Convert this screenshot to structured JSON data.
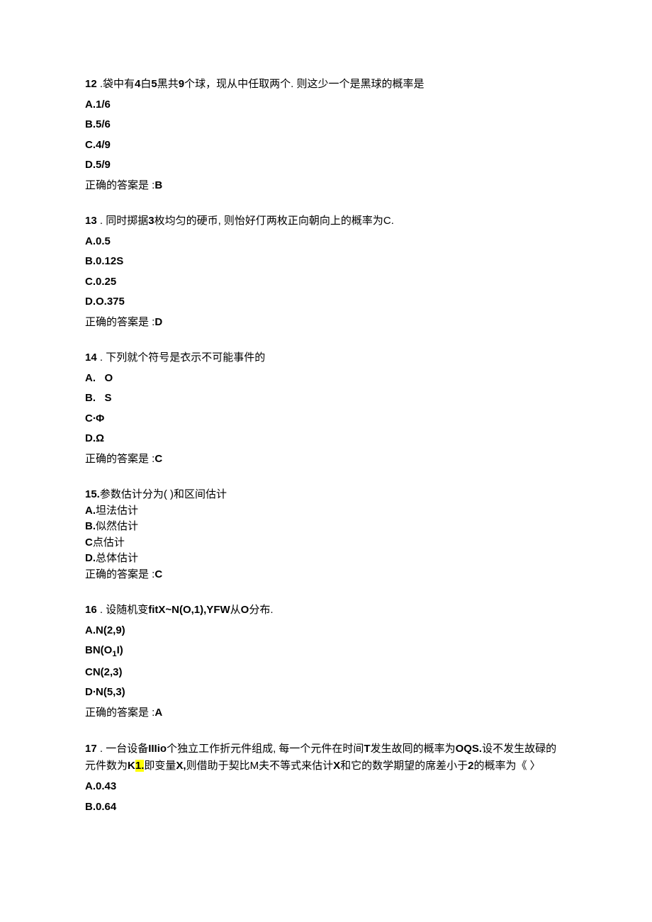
{
  "questions": [
    {
      "num": "12",
      "sep": " .",
      "text": "袋中有",
      "bold1": "4",
      "text2": "白",
      "bold2": "5",
      "text3": "黑共",
      "bold3": "9",
      "text4": "个球，现从中任取两个. 则这少一个是黑球的概率是",
      "options": [
        {
          "label": "A.1/6",
          "bold": true
        },
        {
          "label": "B.5/6",
          "bold": true
        },
        {
          "label": "C.4/9",
          "bold": true
        },
        {
          "label": "D.5/9",
          "bold": true
        }
      ],
      "answer_prefix": "正确的答案是 :",
      "answer": "B"
    },
    {
      "num": "13",
      "sep": " . ",
      "text": "同时掷据",
      "bold1": "3",
      "text2": "枚均匀的硬币, 则怡好仃两枚正向朝向上的概率为C.",
      "options": [
        {
          "label": "A.0.5",
          "bold": true
        },
        {
          "label": "B.0.12S",
          "bold": true
        },
        {
          "label": "C.0.25",
          "bold": true
        },
        {
          "label": "D.O.375",
          "bold": true
        }
      ],
      "answer_prefix": "正确的答案是 :",
      "answer": "D"
    },
    {
      "num": "14",
      "sep": " . ",
      "text": "下列就个符号是衣示不可能事件的",
      "options": [
        {
          "label_a": "A.",
          "label_b": "O",
          "bold": true,
          "spaced": true
        },
        {
          "label_a": "B.",
          "label_b": "S",
          "bold": true,
          "spaced": true
        },
        {
          "label": "C∙Φ",
          "bold": true
        },
        {
          "label": "D.Ω",
          "bold": true
        }
      ],
      "answer_prefix": "正确的答案是 :",
      "answer": "C"
    },
    {
      "num": "15.",
      "text": "参数估计分为(            )和区间估计",
      "options": [
        {
          "label_a": "A.",
          "label_b": "坦法估计",
          "mixed": true
        },
        {
          "label_a": "B.",
          "label_b": "似然估计",
          "mixed": true
        },
        {
          "label_a": "C",
          "label_b": "点估计",
          "mixed": true
        },
        {
          "label_a": "D.",
          "label_b": "总体估计",
          "mixed": true
        }
      ],
      "answer_prefix": "正确的答案是 :",
      "answer": "C",
      "tight": true
    },
    {
      "num": "16",
      "sep": " . ",
      "text": "设随机变",
      "bold1": "fitX~N(O,1),YFW",
      "text2": "从",
      "bold2": "O",
      "text3": "分布.",
      "options": [
        {
          "label": "A.N(2,9)",
          "bold": true
        },
        {
          "label_a": "BN(O",
          "sub": "1",
          "label_b": "I)",
          "bold": true,
          "hassub": true
        },
        {
          "label": "CN(2,3)",
          "bold": true
        },
        {
          "label": "D∙N(5,3)",
          "bold": true
        }
      ],
      "answer_prefix": "正确的答案是 :",
      "answer": "A"
    },
    {
      "num": "17",
      "sep": " . ",
      "text_parts": {
        "t1": "一台设备",
        "b1": "IIIio",
        "t2": "个独立工作折元件组成, 每一个元件在时间",
        "b2": "T",
        "t3": "发生故囘的概率为",
        "b3": "OQS.",
        "t4": "设不发生故碌的元件数为",
        "b4": "K",
        "hl": "1.",
        "t5": "即变量",
        "b5": "X,",
        "t6": "则借助于契比M夫不等式来估计",
        "b6": "X",
        "t7": "和它的数学期望的席差小于",
        "b7": "2",
        "t8": "的概率为《                              〉"
      },
      "options": [
        {
          "label": "A.0.43",
          "bold": true
        },
        {
          "label": "B.0.64",
          "bold": true
        }
      ]
    }
  ]
}
